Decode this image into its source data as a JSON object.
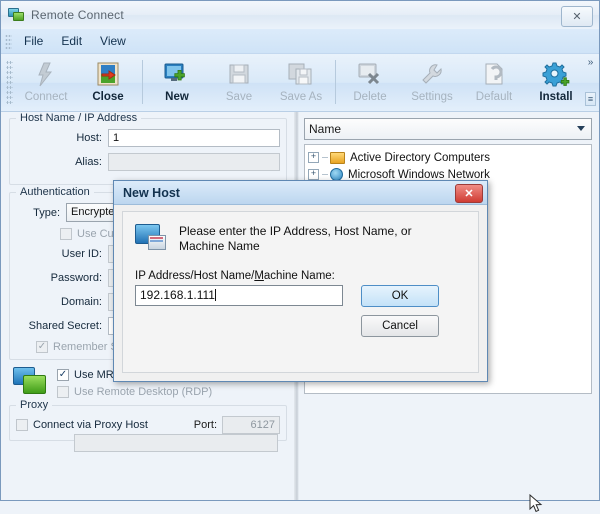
{
  "window": {
    "title": "Remote Connect",
    "close_label": "✕",
    "app_icon": "dual-monitor-icon"
  },
  "menu": {
    "items": [
      "File",
      "Edit",
      "View"
    ]
  },
  "toolbar": {
    "overflow_label": "»",
    "expand_label": "≡",
    "buttons": [
      {
        "label": "Connect",
        "icon": "lightning-bolt-icon",
        "enabled": false
      },
      {
        "label": "Close",
        "icon": "close-door-arrow-icon",
        "enabled": true
      },
      {
        "label": "New",
        "icon": "monitor-plus-icon",
        "enabled": true
      },
      {
        "label": "Save",
        "icon": "floppy-disk-icon",
        "enabled": false
      },
      {
        "label": "Save As",
        "icon": "floppy-disk-copy-icon",
        "enabled": false
      },
      {
        "label": "Delete",
        "icon": "monitor-x-icon",
        "enabled": false
      },
      {
        "label": "Settings",
        "icon": "wrench-icon",
        "enabled": false
      },
      {
        "label": "Default",
        "icon": "page-arrow-icon",
        "enabled": false
      },
      {
        "label": "Install",
        "icon": "gear-plus-icon",
        "enabled": true
      }
    ]
  },
  "host_group": {
    "caption": "Host Name / IP Address",
    "host_label": "Host:",
    "host_value": "1",
    "alias_label": "Alias:",
    "alias_value": ""
  },
  "auth_group": {
    "caption": "Authentication",
    "type_label": "Type:",
    "type_value": "Encrypte",
    "use_current_label": "Use Current",
    "user_id_label": "User ID:",
    "user_id_value": "",
    "password_label": "Password:",
    "password_value": "",
    "domain_label": "Domain:",
    "domain_value": "",
    "shared_secret_label": "Shared Secret:",
    "shared_secret_value": "",
    "remember_label": "Remember Security Credentials",
    "remember_checked": true,
    "check_glyph": "✓"
  },
  "options": {
    "icon": "dual-monitor-blue-green-icon",
    "mirror_driver_label": "Use MRC's Mirror Driver if available",
    "mirror_driver_checked": true,
    "rdp_label": "Use Remote Desktop (RDP)",
    "rdp_checked": false
  },
  "proxy_group": {
    "caption": "Proxy",
    "connect_label": "Connect via Proxy Host",
    "connect_checked": false,
    "port_label": "Port:",
    "port_value": "6127"
  },
  "tree_panel": {
    "sort_value": "Name",
    "nodes": [
      {
        "label": "Active Directory Computers",
        "icon": "folder-icon",
        "expander": "+"
      },
      {
        "label": "Microsoft Windows Network",
        "icon": "network-globe-icon",
        "expander": "+"
      }
    ]
  },
  "dialog": {
    "title": "New Host",
    "close_label": "✕",
    "icon": "monitor-window-icon",
    "message": "Please enter the IP Address, Host Name, or Machine Name",
    "field_label_pre": "IP Address/Host Name/",
    "field_label_accel": "M",
    "field_label_post": "achine Name:",
    "field_value": "192.168.1.111",
    "ok_label": "OK",
    "cancel_label": "Cancel",
    "cursor": "arrow-cursor"
  },
  "colors": {
    "accent": "#1f74b8",
    "titlebar": "#e6eef7",
    "danger": "#cf3c33",
    "check": "#1b3f66"
  }
}
